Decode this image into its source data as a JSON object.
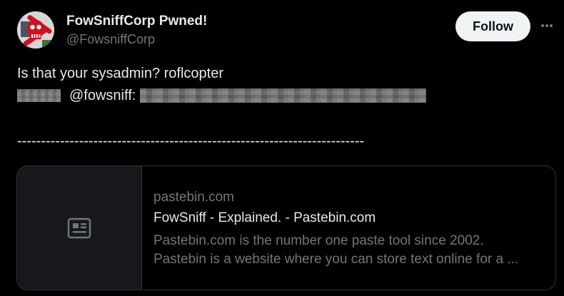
{
  "header": {
    "display_name": "FowSniffCorp Pwned!",
    "handle": "@FowsniffCorp",
    "follow_label": "Follow",
    "avatar_icon": "skull-crossbones-icon",
    "more_icon": "more-horizontal-icon"
  },
  "tweet": {
    "line1": "Is that your sysadmin? roflcopter",
    "line2_domain": "@fowsniff:",
    "dashes": "-------------------------------------------------------------------------"
  },
  "card": {
    "domain": "pastebin.com",
    "title": "FowSniff - Explained. - Pastebin.com",
    "desc_line1": "Pastebin.com is the number one paste tool since 2002.",
    "desc_line2": "Pastebin is a website where you can store text online for a ...",
    "thumb_icon": "article-icon"
  },
  "colors": {
    "background": "#000000",
    "primary_text": "#e7e9ea",
    "secondary_text": "#71767b",
    "follow_button_bg": "#eff3f4",
    "card_border": "#2f3336",
    "avatar_accent": "#d0101e"
  }
}
